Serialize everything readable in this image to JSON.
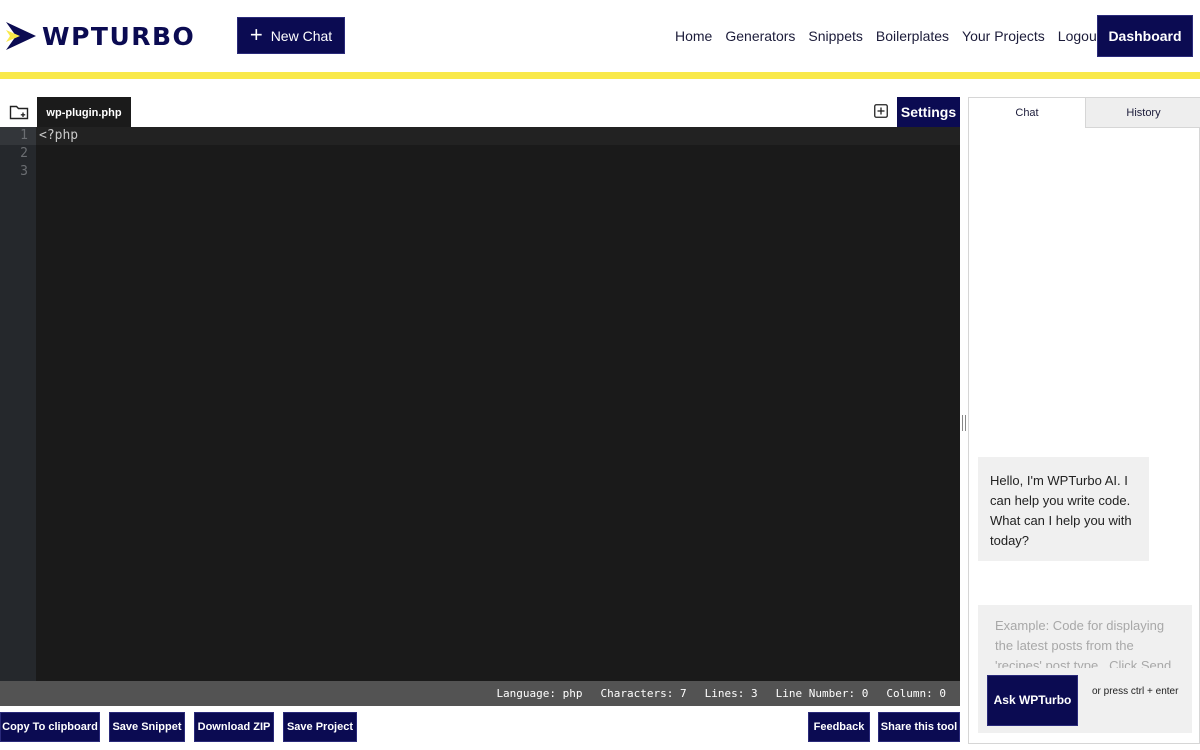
{
  "header": {
    "logo_text": "WPTURBO",
    "new_chat_label": "New Chat",
    "nav": [
      "Home",
      "Generators",
      "Snippets",
      "Boilerplates",
      "Your Projects",
      "Logout"
    ],
    "dashboard_label": "Dashboard",
    "brand_color": "#0b0b52",
    "accent_color": "#f9e94a"
  },
  "editor": {
    "file_tab": "wp-plugin.php",
    "settings_label": "Settings",
    "line_numbers": [
      "1",
      "2",
      "3"
    ],
    "lines": [
      "<?php",
      "",
      ""
    ],
    "status": {
      "language_label": "Language:",
      "language": "php",
      "characters_label": "Characters:",
      "characters": "7",
      "lines_label": "Lines:",
      "lines": "3",
      "line_number_label": "Line Number:",
      "line_number": "0",
      "column_label": "Column:",
      "column": "0"
    }
  },
  "toolbar": {
    "copy": "Copy To clipboard",
    "save_snippet": "Save Snippet",
    "download_zip": "Download ZIP",
    "save_project": "Save Project",
    "feedback": "Feedback",
    "share": "Share this tool"
  },
  "chat": {
    "tabs": [
      "Chat",
      "History"
    ],
    "greeting": "Hello, I'm WPTurbo AI. I can help you write code. What can I help you with today?",
    "placeholder": "Example: Code for displaying the latest posts from the 'recipes' post type . Click Send",
    "ask_label": "Ask WPTurbo",
    "ask_hint": "or press ctrl + enter"
  },
  "icons": {
    "logo": "wpturbo-chevron-logo",
    "new_chat": "plus-icon",
    "folder": "folder-plus-icon",
    "add_file": "add-square-icon"
  }
}
